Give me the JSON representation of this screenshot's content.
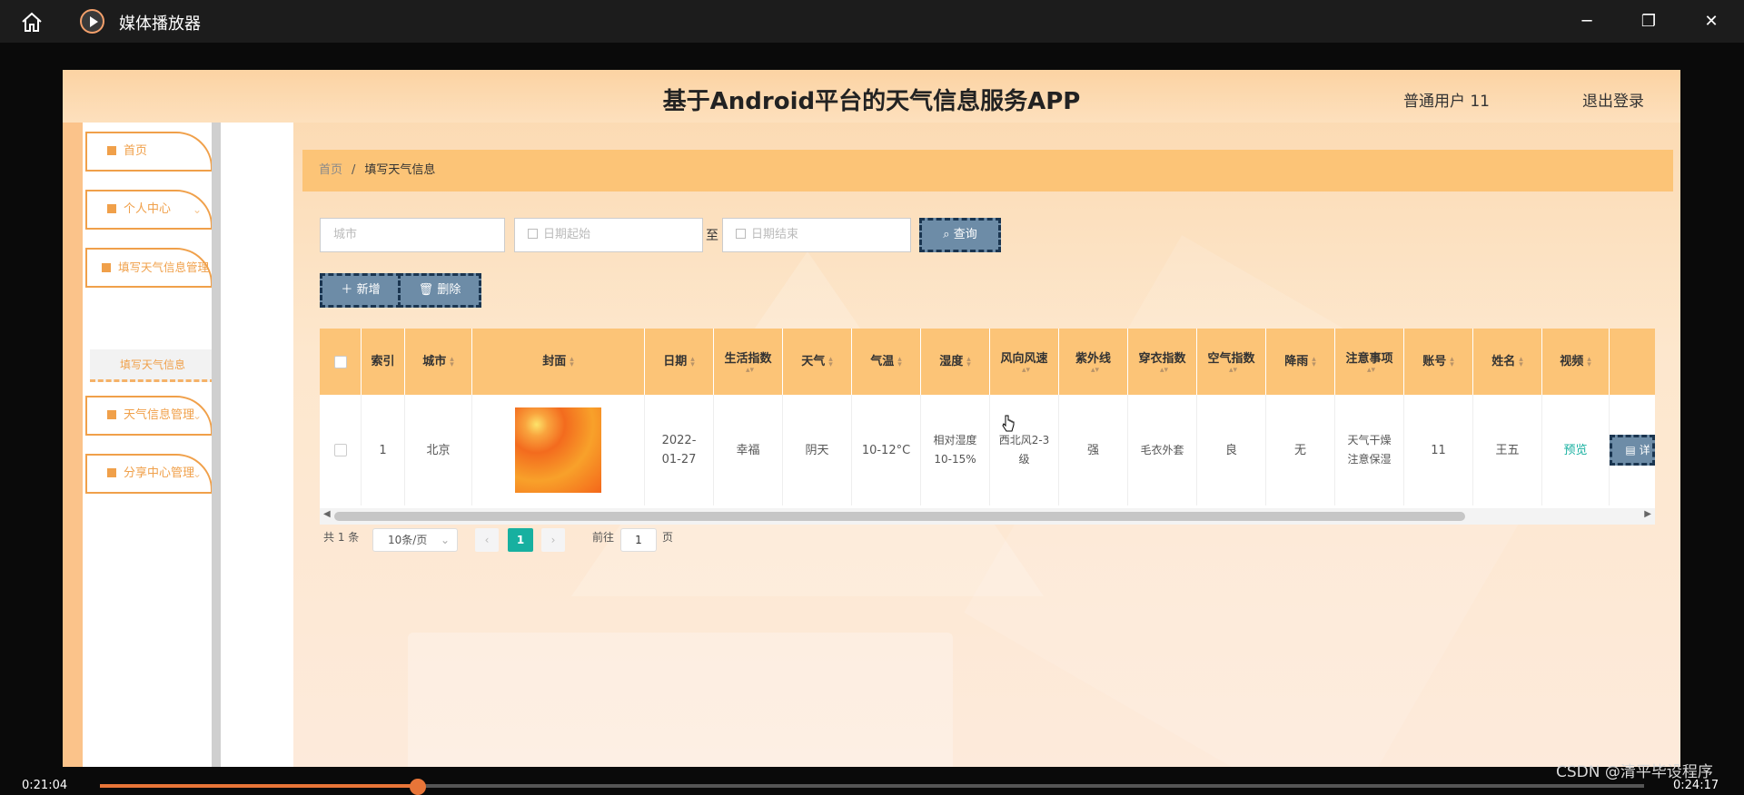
{
  "window": {
    "title": "媒体播放器",
    "minimize": "─",
    "maximize": "❐",
    "close": "✕"
  },
  "app": {
    "title": "基于Android平台的天气信息服务APP",
    "user": "普通用户 11",
    "logout": "退出登录"
  },
  "sidebar": {
    "items": [
      {
        "label": "首页"
      },
      {
        "label": "个人中心"
      },
      {
        "label": "填写天气信息管理"
      },
      {
        "label": "天气信息管理"
      },
      {
        "label": "分享中心管理"
      }
    ],
    "sub_item": "填写天气信息"
  },
  "breadcrumb": {
    "home": "首页",
    "separator": "/",
    "current": "填写天气信息"
  },
  "filters": {
    "city_placeholder": "城市",
    "date_start_placeholder": "日期起始",
    "to": "至",
    "date_end_placeholder": "日期结束",
    "search_label": "查询"
  },
  "actions": {
    "add_label": "新增",
    "delete_label": "删除"
  },
  "table": {
    "headers": [
      "索引",
      "城市",
      "封面",
      "日期",
      "生活指数",
      "天气",
      "气温",
      "湿度",
      "风向风速",
      "紫外线",
      "穿衣指数",
      "空气指数",
      "降雨",
      "注意事项",
      "账号",
      "姓名",
      "视频"
    ],
    "row": {
      "index": "1",
      "city": "北京",
      "date": "2022-01-27",
      "life_index": "幸福",
      "weather": "阴天",
      "temperature": "10-12°C",
      "humidity": "相对湿度10-15%",
      "wind": "西北风2-3级",
      "uv": "强",
      "clothing": "毛衣外套",
      "air": "良",
      "rain": "无",
      "notes": "天气干燥注意保湿",
      "account": "11",
      "name": "王五",
      "video": "预览",
      "detail": "详"
    }
  },
  "pagination": {
    "total": "共 1 条",
    "page_size": "10条/页",
    "prev": "‹",
    "current": "1",
    "next": "›",
    "goto": "前往",
    "goto_value": "1",
    "page_suffix": "页"
  },
  "player": {
    "time_elapsed": "0:21:04",
    "time_total": "0:24:17",
    "progress": 0.21
  },
  "watermark": "CSDN @清平毕设程序",
  "colors": {
    "accent": "#fcc477",
    "menu": "#f0a04a",
    "button": "#6d8ca7",
    "teal": "#17b0a0"
  }
}
